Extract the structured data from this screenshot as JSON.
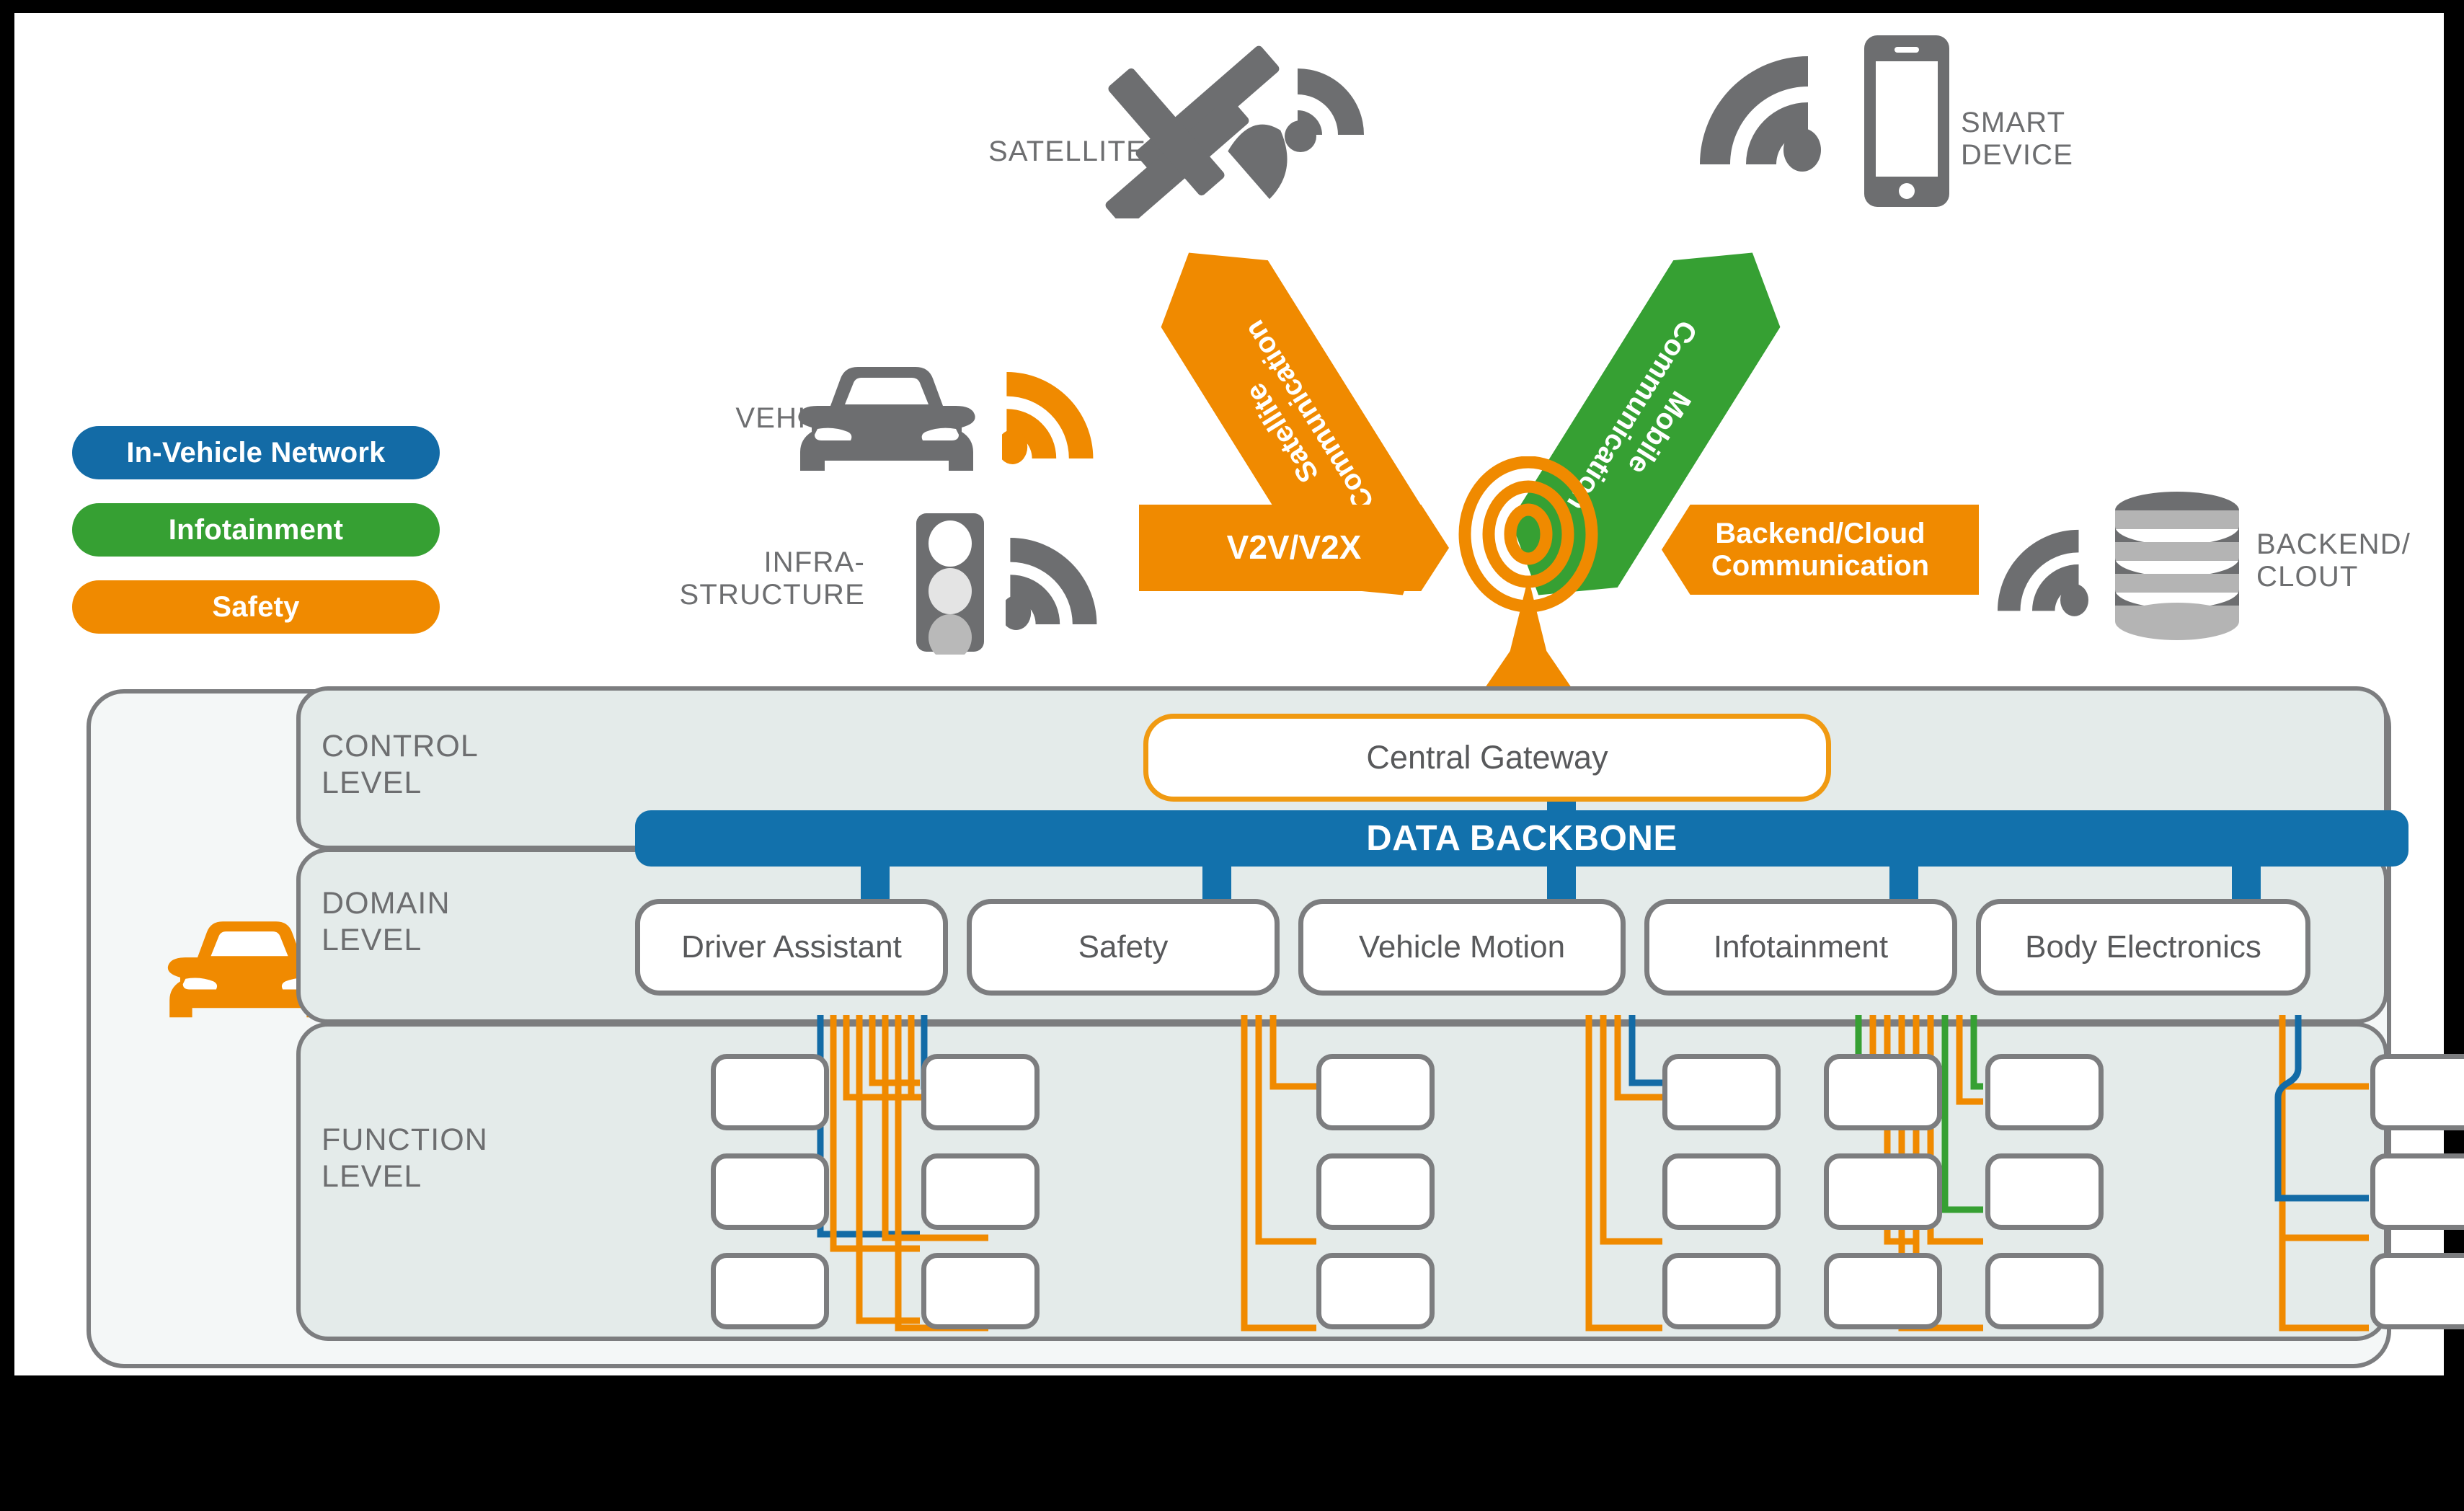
{
  "legend": {
    "items": [
      {
        "label": "In-Vehicle Network",
        "color": "#136ba6"
      },
      {
        "label": "Infotainment",
        "color": "#36a033"
      },
      {
        "label": "Safety",
        "color": "#f08a00"
      }
    ]
  },
  "external_nodes": [
    {
      "id": "satellite",
      "label": "SATELLITE",
      "icon": "satellite-icon",
      "wifi_color": "#6d6e70"
    },
    {
      "id": "smart-device",
      "label": "SMART\nDEVICE",
      "icon": "smartphone-icon",
      "wifi_color": "#6d6e70"
    },
    {
      "id": "vehicle",
      "label": "VEHICLE",
      "icon": "car-icon",
      "wifi_color": "#f08a00"
    },
    {
      "id": "infrastructure",
      "label": "INFRA-\nSTRUCTURE",
      "icon": "traffic-light-icon",
      "wifi_color": "#6d6e70"
    },
    {
      "id": "backend",
      "label": "BACKEND/\nCLOUT",
      "icon": "database-icon",
      "wifi_color": "#6d6e70"
    }
  ],
  "node_labels": {
    "satellite": "SATELLITE",
    "smart_device_line1": "SMART",
    "smart_device_line2": "DEVICE",
    "vehicle": "VEHICLE",
    "infra_line1": "INFRA-",
    "infra_line2": "STRUCTURE",
    "backend_line1": "BACKEND/",
    "backend_line2": "CLOUT"
  },
  "comm_arrows": [
    {
      "id": "satellite-communication",
      "line1": "Satellite",
      "line2": "Communication",
      "color": "#f08a00",
      "direction": "diagonal-left"
    },
    {
      "id": "mobile-communication",
      "line1": "Mobile",
      "line2": "Communication",
      "color": "#36a033",
      "direction": "diagonal-right"
    },
    {
      "id": "v2v-v2x",
      "line1": "V2V/V2X",
      "line2": "",
      "color": "#f08a00",
      "direction": "right"
    },
    {
      "id": "backend-cloud-communication",
      "line1": "Backend/Cloud",
      "line2": "Communication",
      "color": "#f08a00",
      "direction": "left"
    }
  ],
  "hub": {
    "icon": "antenna-broadcast-icon",
    "color": "#f08a00"
  },
  "architecture": {
    "levels": [
      {
        "id": "control-level",
        "line1": "CONTROL",
        "line2": "LEVEL"
      },
      {
        "id": "domain-level",
        "line1": "DOMAIN",
        "line2": "LEVEL"
      },
      {
        "id": "function-level",
        "line1": "FUNCTION",
        "line2": "LEVEL"
      }
    ],
    "gateway": {
      "label": "Central Gateway",
      "border_color": "#f09a12"
    },
    "backbone": {
      "label": "DATA BACKBONE",
      "color": "#1271ac"
    },
    "vehicle_icon": {
      "name": "car-icon",
      "color": "#f08a00"
    },
    "domains": [
      {
        "id": "driver-assistant",
        "label": "Driver Assistant",
        "left_column": true,
        "right_column": true
      },
      {
        "id": "safety",
        "label": "Safety",
        "left_column": false,
        "right_column": true
      },
      {
        "id": "vehicle-motion",
        "label": "Vehicle Motion",
        "left_column": true,
        "right_column": true
      },
      {
        "id": "infotainment",
        "label": "Infotainment",
        "left_column": true,
        "right_column": true
      },
      {
        "id": "body-electronics",
        "label": "Body Electronics",
        "left_column": false,
        "right_column": true
      }
    ],
    "function_rows": 3
  },
  "colors": {
    "in_vehicle_network": "#136ba6",
    "infotainment": "#36a033",
    "safety": "#f08a00",
    "backbone_blue": "#1271ac",
    "gray_icon": "#6d6e70",
    "gray_border": "#7c7d7f",
    "panel_fill": "#e4ebea",
    "outer_fill": "#f4f7f7",
    "text_gray": "#58595b"
  }
}
